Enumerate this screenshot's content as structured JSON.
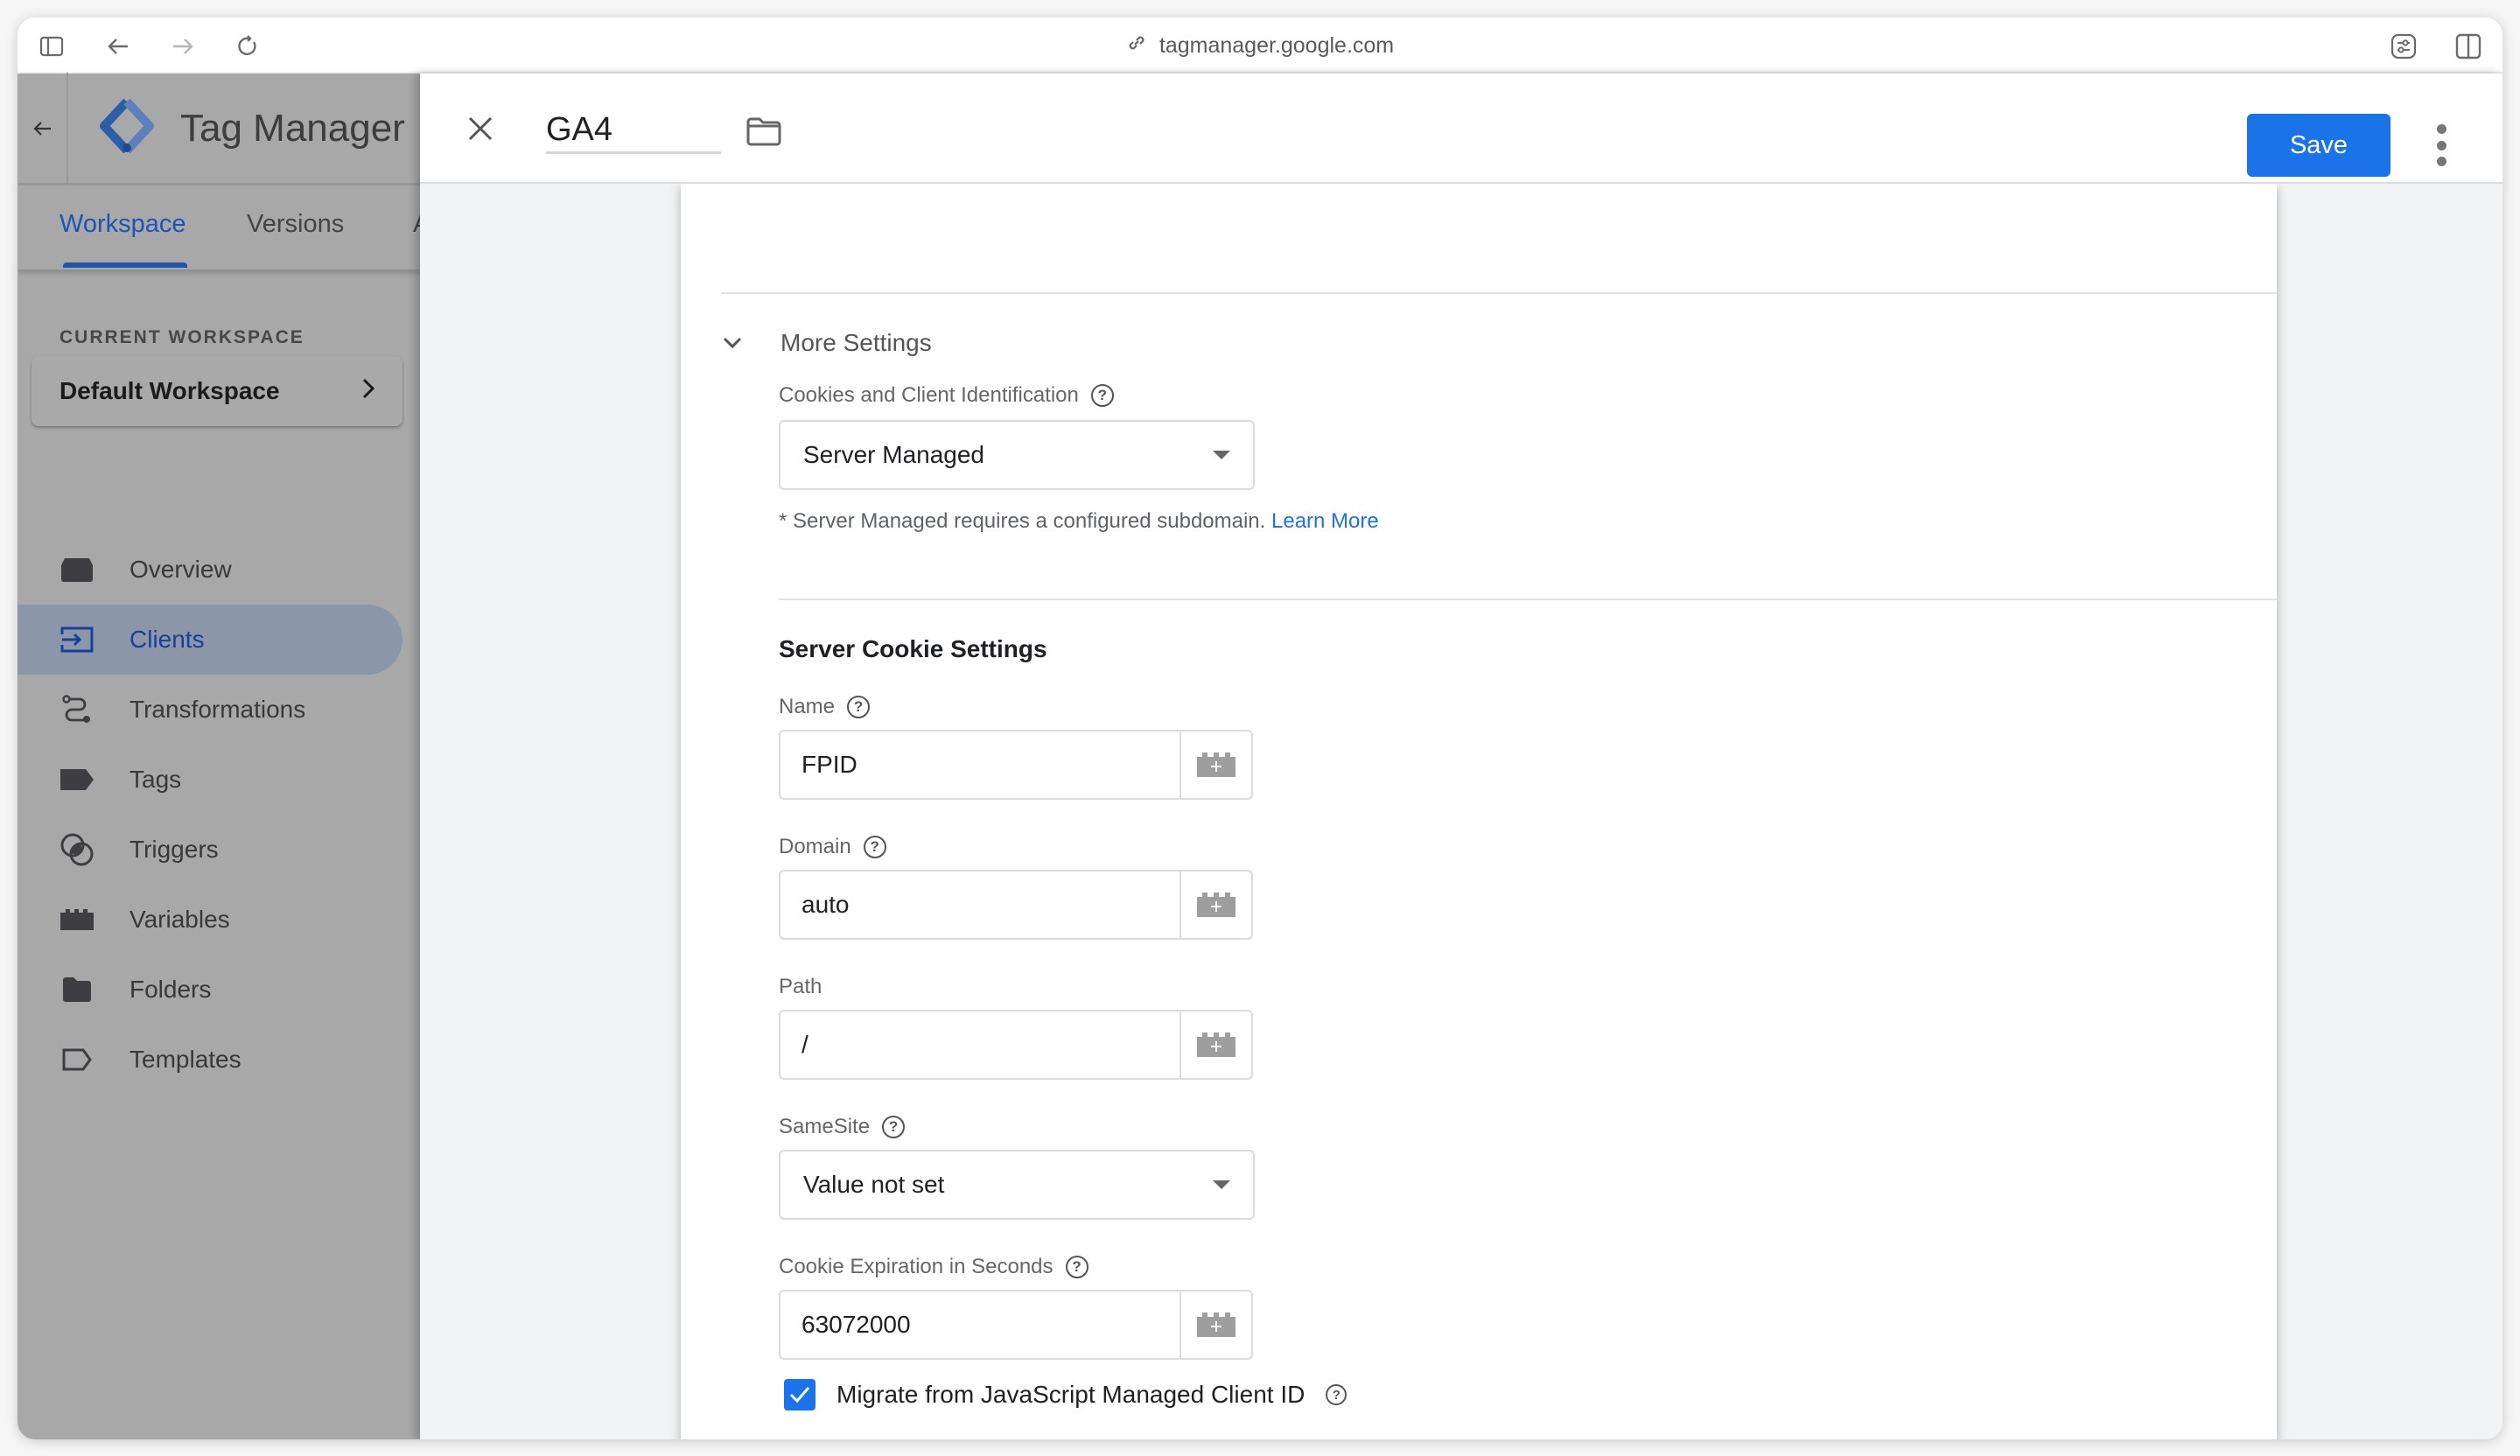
{
  "browser": {
    "url": "tagmanager.google.com"
  },
  "sidebar": {
    "brand": "Tag Manager",
    "tabs": [
      {
        "label": "Workspace",
        "active": true
      },
      {
        "label": "Versions",
        "active": false
      },
      {
        "label": "A",
        "active": false
      }
    ],
    "current_workspace_label": "CURRENT WORKSPACE",
    "current_workspace": "Default Workspace",
    "items": [
      {
        "label": "Overview",
        "icon": "overview-icon",
        "active": false
      },
      {
        "label": "Clients",
        "icon": "clients-icon",
        "active": true
      },
      {
        "label": "Transformations",
        "icon": "transformations-icon",
        "active": false
      },
      {
        "label": "Tags",
        "icon": "tag-icon",
        "active": false
      },
      {
        "label": "Triggers",
        "icon": "triggers-icon",
        "active": false
      },
      {
        "label": "Variables",
        "icon": "variables-icon",
        "active": false
      },
      {
        "label": "Folders",
        "icon": "folder-icon",
        "active": false
      },
      {
        "label": "Templates",
        "icon": "templates-icon",
        "active": false
      }
    ]
  },
  "panel": {
    "title": "GA4",
    "save_label": "Save"
  },
  "form": {
    "more_settings_label": "More Settings",
    "cookies_label": "Cookies and Client Identification",
    "cookies_value": "Server Managed",
    "note_text": "* Server Managed requires a configured subdomain.",
    "note_link": "Learn More",
    "section_title": "Server Cookie Settings",
    "name_label": "Name",
    "name_value": "FPID",
    "domain_label": "Domain",
    "domain_value": "auto",
    "path_label": "Path",
    "path_value": "/",
    "samesite_label": "SameSite",
    "samesite_value": "Value not set",
    "expiration_label": "Cookie Expiration in Seconds",
    "expiration_value": "63072000",
    "migrate_label": "Migrate from JavaScript Managed Client ID",
    "migrate_checked": true
  },
  "colors": {
    "accent": "#1a73e8",
    "active_nav_text": "#1a3f9a"
  }
}
